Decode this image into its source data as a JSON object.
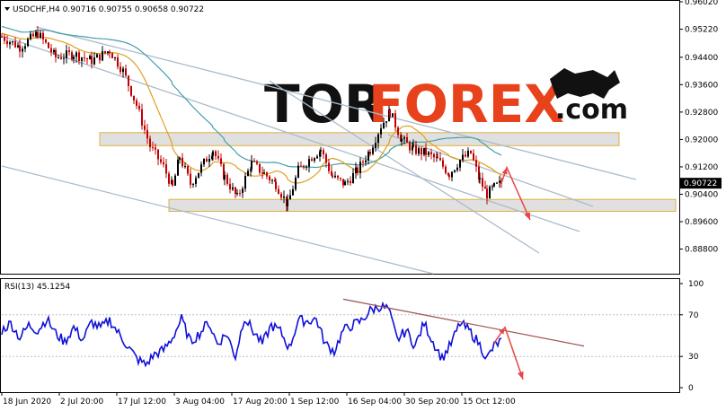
{
  "chart_data": [
    {
      "type": "candlestick",
      "symbol_header": "USDCHF,H4  0.90716  0.90755  0.90658  0.90722",
      "ylim": [
        0.8808,
        0.9602
      ],
      "y_ticks": [
        "0.96020",
        "0.95220",
        "0.94400",
        "0.93600",
        "0.92800",
        "0.92000",
        "0.91200",
        "0.90400",
        "0.89600",
        "0.88800"
      ],
      "current_price": "0.90722",
      "x_tick_labels": [
        "18 Jun 2020",
        "2 Jul 20:00",
        "17 Jul 12:00",
        "3 Aug 04:00",
        "17 Aug 20:00",
        "1 Sep 12:00",
        "16 Sep 04:00",
        "30 Sep 20:00",
        "15 Oct 12:00"
      ],
      "price_path": [
        [
          0,
          0.95
        ],
        [
          20,
          0.947
        ],
        [
          40,
          0.951
        ],
        [
          60,
          0.944
        ],
        [
          80,
          0.945
        ],
        [
          100,
          0.943
        ],
        [
          120,
          0.946
        ],
        [
          135,
          0.94
        ],
        [
          150,
          0.93
        ],
        [
          165,
          0.918
        ],
        [
          180,
          0.912
        ],
        [
          190,
          0.906
        ],
        [
          198,
          0.915
        ],
        [
          210,
          0.907
        ],
        [
          222,
          0.912
        ],
        [
          235,
          0.917
        ],
        [
          248,
          0.909
        ],
        [
          262,
          0.903
        ],
        [
          278,
          0.913
        ],
        [
          292,
          0.91
        ],
        [
          305,
          0.907
        ],
        [
          318,
          0.901
        ],
        [
          330,
          0.911
        ],
        [
          345,
          0.915
        ],
        [
          355,
          0.917
        ],
        [
          368,
          0.909
        ],
        [
          382,
          0.907
        ],
        [
          396,
          0.911
        ],
        [
          410,
          0.917
        ],
        [
          422,
          0.924
        ],
        [
          432,
          0.928
        ],
        [
          445,
          0.92
        ],
        [
          458,
          0.917
        ],
        [
          472,
          0.916
        ],
        [
          485,
          0.914
        ],
        [
          498,
          0.91
        ],
        [
          510,
          0.914
        ],
        [
          522,
          0.916
        ],
        [
          532,
          0.908
        ],
        [
          540,
          0.904
        ],
        [
          548,
          0.906
        ],
        [
          556,
          0.9072
        ]
      ],
      "support_zone": [
        0.899,
        0.9025
      ],
      "resistance_zone": [
        0.9182,
        0.922
      ],
      "forecast_price": [
        [
          556,
          0.9072
        ],
        [
          562,
          0.9118
        ],
        [
          588,
          0.8965
        ]
      ]
    },
    {
      "type": "line",
      "indicator": "RSI(13) 45.1254",
      "ylim": [
        0,
        100
      ],
      "y_ticks": [
        "100",
        "70",
        "30",
        "0"
      ],
      "rsi_path": [
        [
          0,
          55
        ],
        [
          10,
          62
        ],
        [
          20,
          48
        ],
        [
          30,
          60
        ],
        [
          40,
          55
        ],
        [
          50,
          66
        ],
        [
          60,
          52
        ],
        [
          70,
          44
        ],
        [
          80,
          58
        ],
        [
          90,
          46
        ],
        [
          100,
          63
        ],
        [
          110,
          57
        ],
        [
          120,
          65
        ],
        [
          130,
          52
        ],
        [
          140,
          40
        ],
        [
          150,
          28
        ],
        [
          160,
          22
        ],
        [
          170,
          32
        ],
        [
          180,
          36
        ],
        [
          190,
          48
        ],
        [
          200,
          66
        ],
        [
          210,
          44
        ],
        [
          220,
          52
        ],
        [
          230,
          63
        ],
        [
          240,
          42
        ],
        [
          250,
          52
        ],
        [
          260,
          30
        ],
        [
          270,
          68
        ],
        [
          280,
          54
        ],
        [
          290,
          42
        ],
        [
          300,
          60
        ],
        [
          310,
          54
        ],
        [
          320,
          38
        ],
        [
          330,
          65
        ],
        [
          340,
          64
        ],
        [
          350,
          66
        ],
        [
          360,
          42
        ],
        [
          370,
          35
        ],
        [
          380,
          55
        ],
        [
          390,
          60
        ],
        [
          400,
          64
        ],
        [
          410,
          74
        ],
        [
          420,
          78
        ],
        [
          430,
          76
        ],
        [
          440,
          46
        ],
        [
          450,
          55
        ],
        [
          460,
          40
        ],
        [
          470,
          62
        ],
        [
          480,
          44
        ],
        [
          490,
          28
        ],
        [
          500,
          42
        ],
        [
          510,
          62
        ],
        [
          520,
          55
        ],
        [
          530,
          44
        ],
        [
          540,
          28
        ],
        [
          548,
          40
        ],
        [
          556,
          45
        ]
      ],
      "trend_line": [
        [
          380,
          85
        ],
        [
          648,
          40
        ]
      ],
      "forecast_rsi": [
        [
          548,
          43
        ],
        [
          560,
          58
        ],
        [
          580,
          8
        ]
      ]
    }
  ],
  "watermark": {
    "tor": "TOR",
    "forex": "FOREX",
    "com": ".com"
  },
  "colors": {
    "candle_up": "#000000",
    "candle_down": "#c00000",
    "ma_slow": "#45a0a8",
    "ma_fast": "#e0a020",
    "channel": "#a9bbcc",
    "zone_fill": "#d8d8d8",
    "zone_border": "#e0b040",
    "forecast": "#e64646",
    "rsi_line": "#1010d8",
    "rsi_trend": "#a05050"
  }
}
